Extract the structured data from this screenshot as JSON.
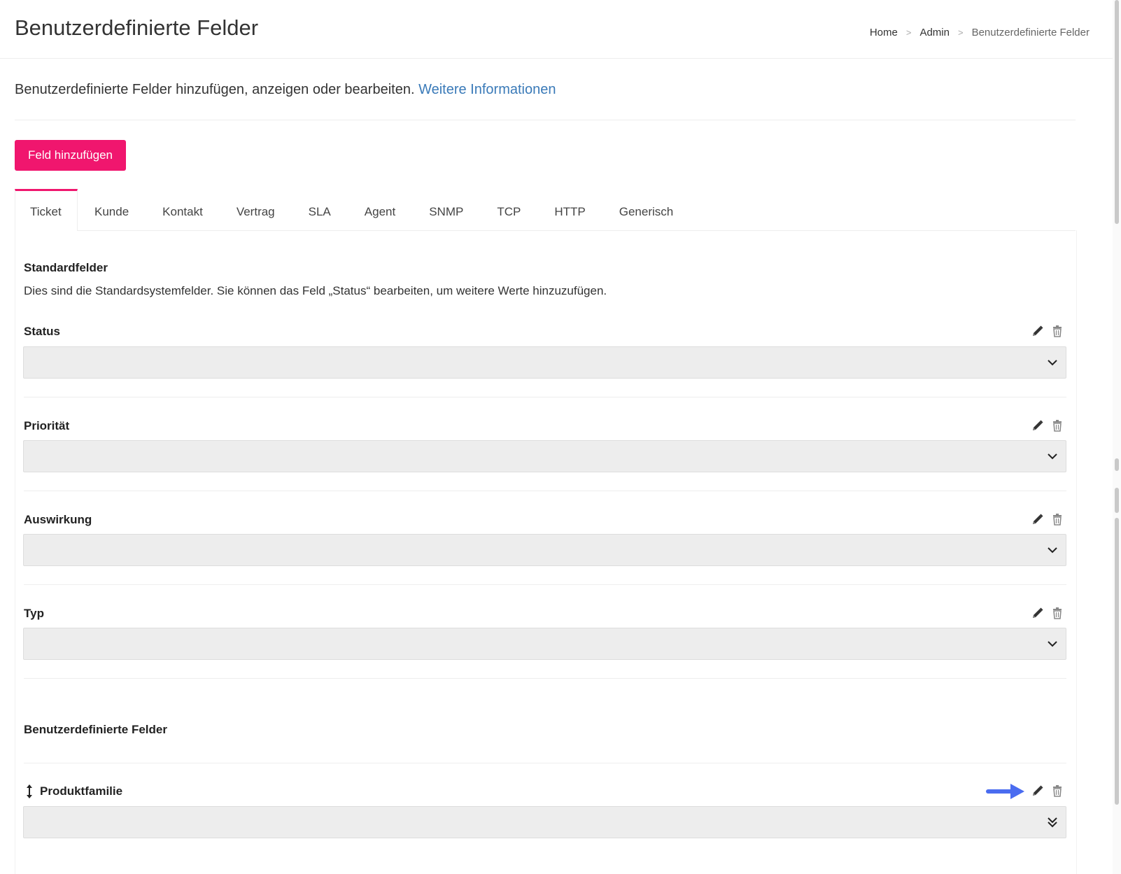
{
  "header": {
    "title": "Benutzerdefinierte Felder",
    "breadcrumb": [
      "Home",
      "Admin",
      "Benutzerdefinierte Felder"
    ],
    "breadcrumb_separator": ">"
  },
  "intro": {
    "text": "Benutzerdefinierte Felder hinzufügen, anzeigen oder bearbeiten.",
    "link": "Weitere Informationen"
  },
  "actions": {
    "add_field": "Feld hinzufügen"
  },
  "tabs": [
    "Ticket",
    "Kunde",
    "Kontakt",
    "Vertrag",
    "SLA",
    "Agent",
    "SNMP",
    "TCP",
    "HTTP",
    "Generisch"
  ],
  "active_tab": "Ticket",
  "standard": {
    "title": "Standardfelder",
    "description": "Dies sind die Standardsystemfelder. Sie können das Feld „Status“ bearbeiten, um weitere Werte hinzuzufügen.",
    "fields": [
      "Status",
      "Priorität",
      "Auswirkung",
      "Typ"
    ]
  },
  "custom": {
    "title": "Benutzerdefinierte Felder",
    "fields": [
      "Produktfamilie"
    ]
  },
  "icons": {
    "edit": "pencil-icon",
    "delete": "trash-icon",
    "dropdown": "chevron-down-icon",
    "multi_dropdown": "double-chevron-down-icon",
    "reorder": "vertical-arrows-icon",
    "pointer": "arrow-right-icon"
  },
  "colors": {
    "accent": "#f0166e",
    "link": "#3a7ab8",
    "pointer_arrow": "#4a6cf0",
    "select_bg": "#ededed"
  }
}
